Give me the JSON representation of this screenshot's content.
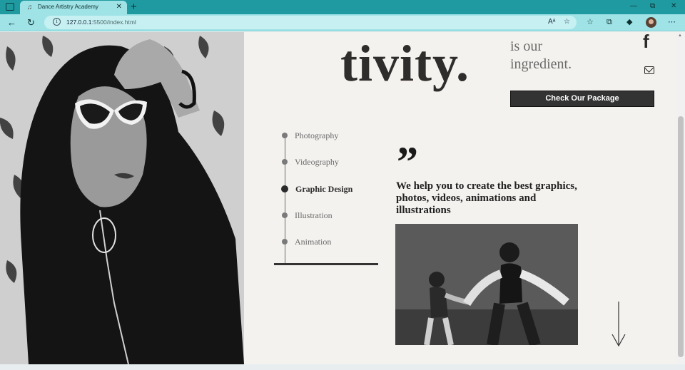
{
  "browser": {
    "tab_title": "Dance Artistry Academy",
    "url_host": "127.0.0.1",
    "url_path": ":5500/index.html",
    "new_tab_glyph": "+",
    "close_glyph": "✕",
    "minimize_glyph": "—",
    "restore_glyph": "⧉",
    "window_close_glyph": "✕",
    "back_glyph": "←",
    "reload_glyph": "↻",
    "more_glyph": "⋯",
    "read_aloud_glyph": "Aᵃ",
    "favorite_glyph": "☆",
    "favorites_glyph": "☆",
    "collections_glyph": "⧉",
    "extension_glyph": "◆",
    "info_glyph": "i"
  },
  "hero": {
    "headline": "tivity.",
    "tagline_line1": "is our",
    "tagline_line2": "ingredient.",
    "social_facebook": "f",
    "cta_label": "Check Our Package"
  },
  "services": {
    "items": [
      {
        "label": "Photography",
        "active": false
      },
      {
        "label": "Videography",
        "active": false
      },
      {
        "label": "Graphic Design",
        "active": true
      },
      {
        "label": "Illustration",
        "active": false
      },
      {
        "label": "Animation",
        "active": false
      }
    ]
  },
  "quote": {
    "mark": "”",
    "text": "We help you to create the best graphics, photos, videos, animations and illustrations"
  },
  "icons": {
    "facebook": "facebook-icon",
    "mail": "mail-icon",
    "arrow": "arrow-down-icon"
  },
  "colors": {
    "browser_tabbar": "#1f9aa0",
    "browser_navbar": "#9fe3e6",
    "page_bg": "#f4f2ef",
    "cta_bg": "#333333",
    "text_dark": "#2f2d2c"
  }
}
